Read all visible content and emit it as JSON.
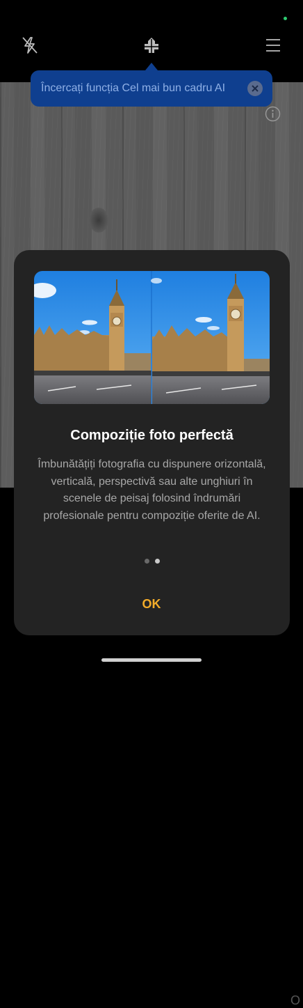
{
  "tooltip": {
    "text": "Încercați funcția Cel mai bun cadru AI"
  },
  "dialog": {
    "title": "Compoziție foto perfectă",
    "body": "Îmbunătățiți fotografia cu dispunere orizontală, verticală, perspectivă sau alte unghiuri în scenele de peisaj folosind îndrumări profesionale pentru compoziție oferite de AI.",
    "ok_label": "OK",
    "pages": 2,
    "current_page": 2
  },
  "side_text": "O",
  "icons": {
    "flash": "flash-off-icon",
    "composition": "composition-icon",
    "menu": "menu-icon",
    "close": "close-icon",
    "info": "info-icon"
  },
  "colors": {
    "tooltip_bg": "#0f3f8f",
    "accent": "#f3ac2a",
    "dialog_bg": "#232323"
  }
}
